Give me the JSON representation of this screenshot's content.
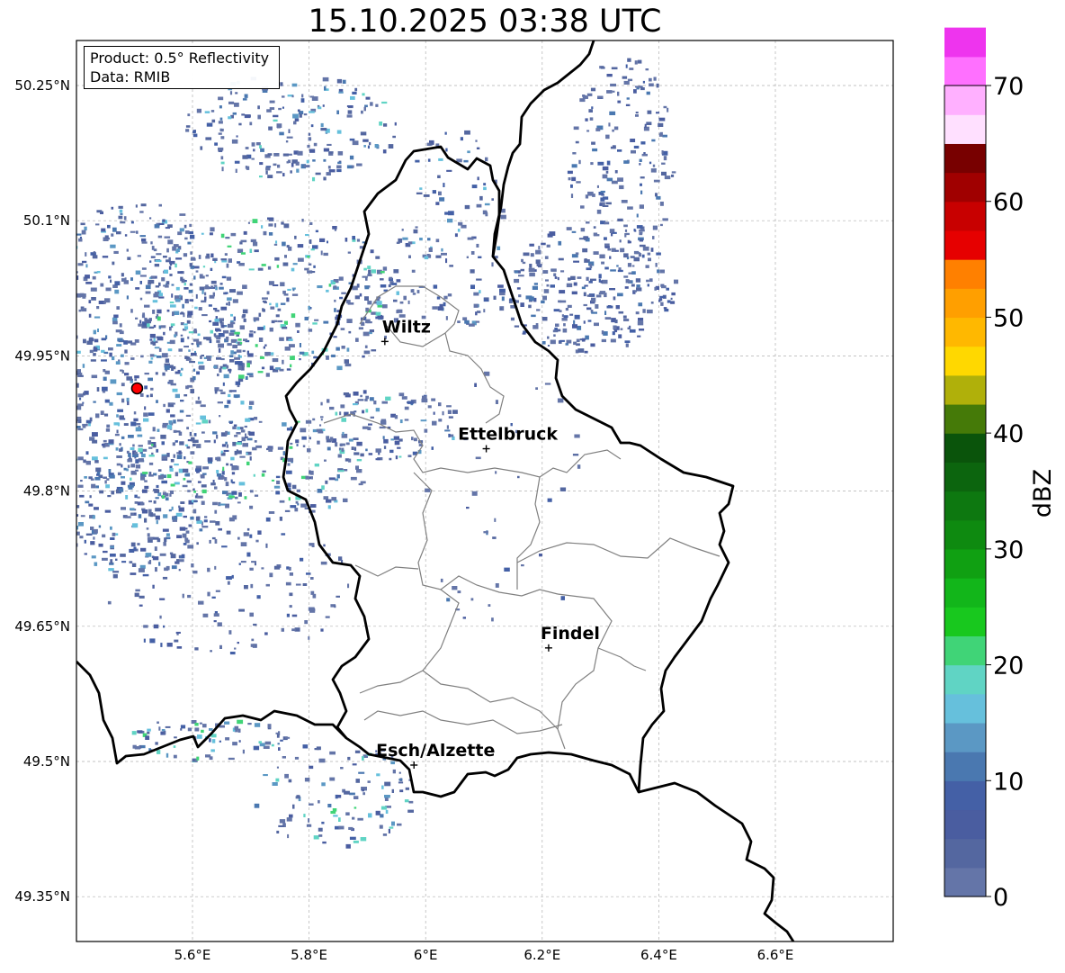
{
  "title": "15.10.2025 03:38 UTC",
  "info_box": {
    "product_line": "Product: 0.5° Reflectivity",
    "data_line": "Data: RMIB"
  },
  "map": {
    "lon_ticks": [
      {
        "value": 5.6,
        "label": "5.6°E"
      },
      {
        "value": 5.8,
        "label": "5.8°E"
      },
      {
        "value": 6.0,
        "label": "6°E"
      },
      {
        "value": 6.2,
        "label": "6.2°E"
      },
      {
        "value": 6.4,
        "label": "6.4°E"
      },
      {
        "value": 6.6,
        "label": "6.6°E"
      }
    ],
    "lat_ticks": [
      {
        "value": 50.25,
        "label": "50.25°N"
      },
      {
        "value": 50.1,
        "label": "50.1°N"
      },
      {
        "value": 49.95,
        "label": "49.95°N"
      },
      {
        "value": 49.8,
        "label": "49.8°N"
      },
      {
        "value": 49.65,
        "label": "49.65°N"
      },
      {
        "value": 49.5,
        "label": "49.5°N"
      },
      {
        "value": 49.35,
        "label": "49.35°N"
      }
    ],
    "cities": [
      {
        "name": "Wiltz",
        "lon": 5.93,
        "lat": 49.966
      },
      {
        "name": "Ettelbruck",
        "lon": 6.104,
        "lat": 49.847
      },
      {
        "name": "Findel",
        "lon": 6.211,
        "lat": 49.626
      },
      {
        "name": "Esch/Alzette",
        "lon": 5.98,
        "lat": 49.496
      }
    ],
    "radar_site": {
      "lon": 5.505,
      "lat": 49.914,
      "color": "#ff0000"
    },
    "border_color": "#000000",
    "canton_color": "#808080",
    "grid_color": "#b0b0b0"
  },
  "colorbar": {
    "label": "dBZ",
    "min": 0,
    "max": 70,
    "step": 2.5,
    "ticks": [
      {
        "value": 0,
        "label": "0"
      },
      {
        "value": 10,
        "label": "10"
      },
      {
        "value": 20,
        "label": "20"
      },
      {
        "value": 30,
        "label": "30"
      },
      {
        "value": 40,
        "label": "40"
      },
      {
        "value": 50,
        "label": "50"
      },
      {
        "value": 60,
        "label": "60"
      },
      {
        "value": 70,
        "label": "70"
      }
    ],
    "colors": [
      "#6475a8",
      "#5467a0",
      "#4a5da0",
      "#4460a6",
      "#4a78b0",
      "#5b98c4",
      "#66c0dc",
      "#60d4c4",
      "#40d477",
      "#18c81e",
      "#12b61a",
      "#10a012",
      "#0e8a10",
      "#0d7810",
      "#0c650e",
      "#0a540b",
      "#457a08",
      "#b0b00a",
      "#ffd800",
      "#ffb800",
      "#ff9f00",
      "#ff8000",
      "#e60000",
      "#c80000",
      "#a00000",
      "#780000",
      "#ffe0ff",
      "#ffb0ff",
      "#ff70ff",
      "#ee34ee"
    ]
  }
}
